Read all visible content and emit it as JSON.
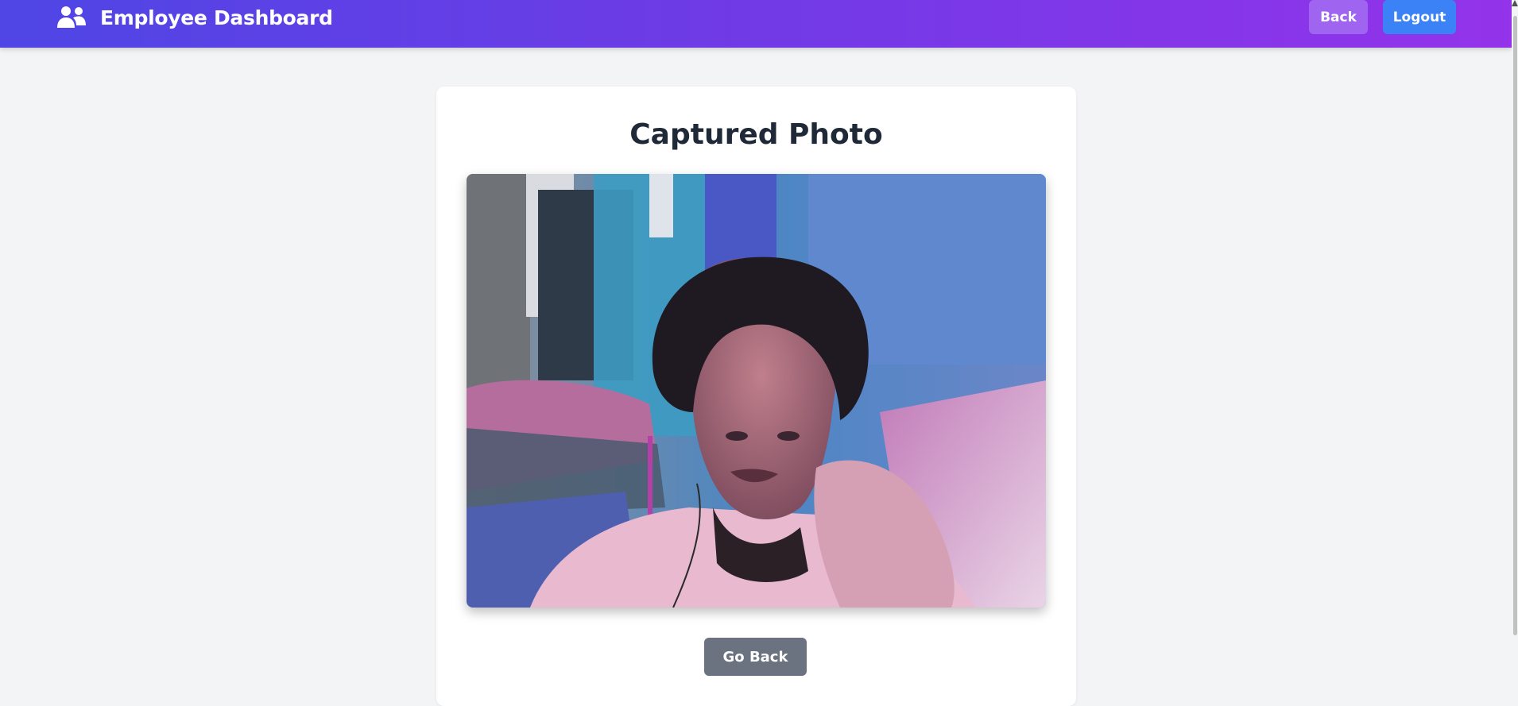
{
  "header": {
    "title": "Employee Dashboard",
    "icon": "users-icon",
    "back_label": "Back",
    "logout_label": "Logout"
  },
  "main": {
    "title": "Captured Photo",
    "photo_alt": "Captured webcam photo",
    "go_back_label": "Go Back"
  },
  "colors": {
    "nav_gradient_start": "#4f46e5",
    "nav_gradient_end": "#9333ea",
    "back_button": "#9f64f0",
    "logout_button": "#3b82f6",
    "go_back_button": "#6b7280",
    "page_background": "#f3f4f6"
  }
}
